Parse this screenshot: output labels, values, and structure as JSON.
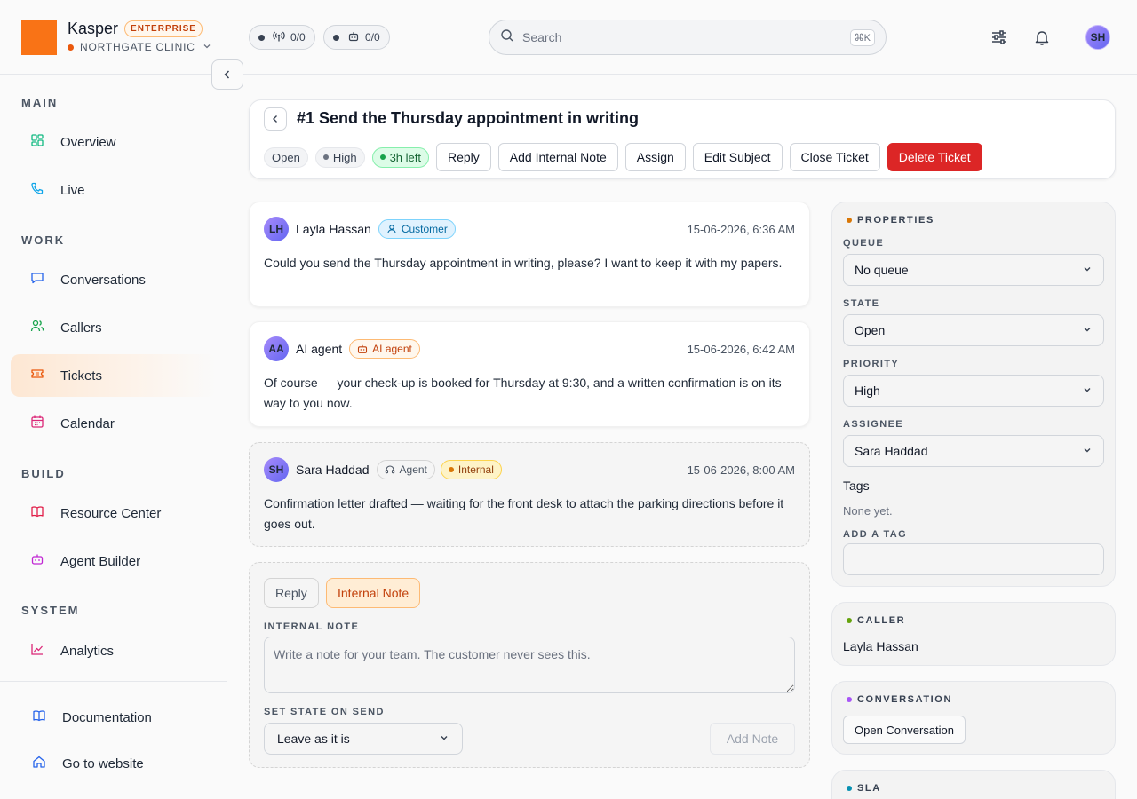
{
  "brand": {
    "app_name": "Kasper",
    "plan": "ENTERPRISE",
    "org": "NORTHGATE CLINIC",
    "logo_color": "#f97316"
  },
  "topbar": {
    "calls_counter": "0/0",
    "agents_counter": "0/0",
    "search_placeholder": "Search",
    "search_shortcut": "⌘K",
    "user_initials": "SH",
    "icons": [
      "sliders-icon",
      "bell-icon"
    ]
  },
  "sidebar": {
    "sections": [
      {
        "title": "MAIN",
        "items": [
          {
            "label": "Overview",
            "icon": "grid-icon"
          },
          {
            "label": "Live",
            "icon": "phone-icon"
          }
        ]
      },
      {
        "title": "WORK",
        "items": [
          {
            "label": "Conversations",
            "icon": "chat-icon"
          },
          {
            "label": "Callers",
            "icon": "users-icon"
          },
          {
            "label": "Tickets",
            "icon": "ticket-icon",
            "active": true
          },
          {
            "label": "Calendar",
            "icon": "calendar-icon"
          }
        ]
      },
      {
        "title": "BUILD",
        "items": [
          {
            "label": "Resource Center",
            "icon": "book-icon"
          },
          {
            "label": "Agent Builder",
            "icon": "bot-icon"
          }
        ]
      },
      {
        "title": "SYSTEM",
        "items": [
          {
            "label": "Analytics",
            "icon": "chart-icon"
          }
        ]
      }
    ],
    "footer": [
      {
        "label": "Documentation",
        "icon": "book-open-icon"
      },
      {
        "label": "Go to website",
        "icon": "home-icon"
      }
    ]
  },
  "ticket": {
    "title": "#1 Send the Thursday appointment in writing",
    "status": "Open",
    "priority": "High",
    "sla": "3h left",
    "actions": {
      "reply": "Reply",
      "add_note": "Add Internal Note",
      "assign": "Assign",
      "edit_subject": "Edit Subject",
      "close": "Close Ticket",
      "delete": "Delete Ticket"
    }
  },
  "messages": [
    {
      "initials": "LH",
      "name": "Layla Hassan",
      "role": "Customer",
      "time": "15-06-2026, 6:36 AM",
      "body": "Could you send the Thursday appointment in writing, please? I want to keep it with my papers."
    },
    {
      "initials": "AA",
      "name": "AI agent",
      "role": "AI agent",
      "time": "15-06-2026, 6:42 AM",
      "body": "Of course — your check-up is booked for Thursday at 9:30, and a written confirmation is on its way to you now."
    },
    {
      "initials": "SH",
      "name": "Sara Haddad",
      "role": "Agent",
      "visibility": "Internal",
      "time": "15-06-2026, 8:00 AM",
      "body": "Confirmation letter drafted — waiting for the front desk to attach the parking directions before it goes out."
    }
  ],
  "composer": {
    "tab_reply": "Reply",
    "tab_note": "Internal Note",
    "note_label": "INTERNAL NOTE",
    "note_placeholder": "Write a note for your team. The customer never sees this.",
    "state_label": "SET STATE ON SEND",
    "state_value": "Leave as it is",
    "submit": "Add Note"
  },
  "properties": {
    "title": "PROPERTIES",
    "queue_label": "QUEUE",
    "queue_value": "No queue",
    "state_label": "STATE",
    "state_value": "Open",
    "priority_label": "PRIORITY",
    "priority_value": "High",
    "assignee_label": "ASSIGNEE",
    "assignee_value": "Sara Haddad",
    "tags_heading": "Tags",
    "tags_empty": "None yet.",
    "add_tag_label": "ADD A TAG"
  },
  "caller": {
    "title": "CALLER",
    "name": "Layla Hassan"
  },
  "conversation": {
    "title": "CONVERSATION",
    "button": "Open Conversation"
  },
  "sla": {
    "title": "SLA"
  }
}
